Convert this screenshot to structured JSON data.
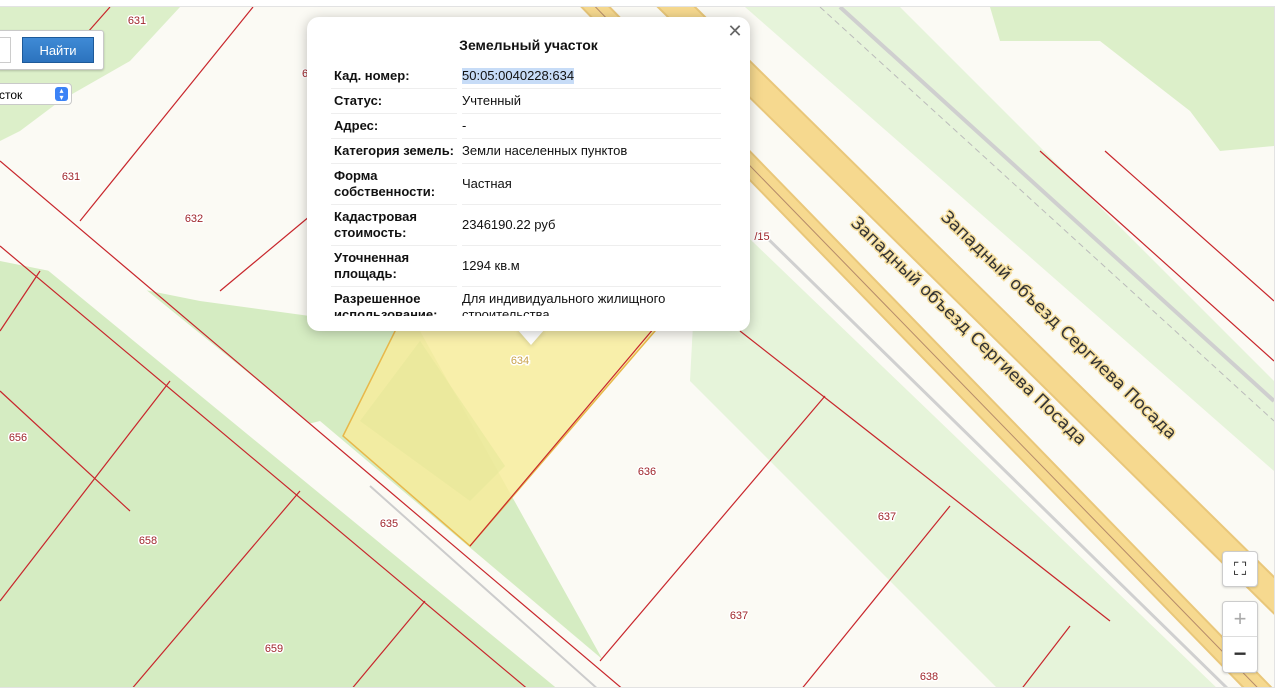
{
  "search": {
    "button_label": "Найти",
    "input_value": "",
    "type_select_value": "сток"
  },
  "popup": {
    "title": "Земельный участок",
    "close_icon": "close-icon",
    "rows": [
      {
        "label": "Кад. номер:",
        "value": "50:05:0040228:634"
      },
      {
        "label": "Статус:",
        "value": "Учтенный"
      },
      {
        "label": "Адрес:",
        "value": "-"
      },
      {
        "label": "Категория земель:",
        "value": "Земли населенных пунктов"
      },
      {
        "label": "Форма собственности:",
        "value": "Частная"
      },
      {
        "label": "Кадастровая стоимость:",
        "value": "2346190.22 руб"
      },
      {
        "label": "Уточненная площадь:",
        "value": "1294 кв.м"
      },
      {
        "label": "Разрешенное использование:",
        "value": "Для индивидуального жилищного строительства"
      }
    ]
  },
  "map": {
    "road_labels": [
      "Западный объезд Сергиева Посада",
      "Западный объезд Сергиева Посада"
    ],
    "parcel_labels": [
      "631",
      "631",
      "632",
      "6",
      "634",
      "636",
      "637",
      "637",
      "638",
      "635",
      "656",
      "658",
      "659",
      "/15"
    ],
    "colors": {
      "parcel_border": "#c8262c",
      "selected_parcel": "#f7ec9c",
      "road": "#f6d78e",
      "green": "#d9efc6"
    }
  },
  "controls": {
    "fullscreen_icon": "fullscreen-icon",
    "zoom_in": "+",
    "zoom_out": "−"
  }
}
